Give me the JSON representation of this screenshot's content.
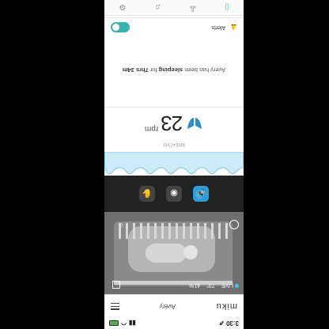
{
  "status_bar": {
    "time": "3:30",
    "arrow": "⇗"
  },
  "app_bar": {
    "logo": "miku",
    "baby_name": "Avery"
  },
  "video": {
    "live_label": "LIVE",
    "temperature": "73°",
    "humidity": "41%"
  },
  "controls": [
    {
      "name": "speaker-icon",
      "glyph": "🔊",
      "active": true
    },
    {
      "name": "talk-icon",
      "glyph": "◉",
      "active": false
    },
    {
      "name": "audio-off-icon",
      "glyph": "✋",
      "active": false
    }
  ],
  "breathing": {
    "label": "BREATHS",
    "value": "23",
    "unit": "rpm"
  },
  "sleep_summary": {
    "prefix": "Avery has been ",
    "state": "sleeping",
    "middle": " for ",
    "duration": "7hrs 34m"
  },
  "alerts": {
    "label": "Alerts",
    "enabled": true
  },
  "tabs": [
    {
      "name": "tab-monitor-icon",
      "glyph": "▯",
      "active": true
    },
    {
      "name": "tab-chart-icon",
      "glyph": "╩",
      "active": false
    },
    {
      "name": "tab-bell-icon",
      "glyph": "♫",
      "active": false
    },
    {
      "name": "tab-settings-icon",
      "glyph": "⚙",
      "active": false
    }
  ],
  "colors": {
    "accent": "#3ec7f0",
    "toggle": "#3ab4a8",
    "control_bar": "#222222"
  }
}
